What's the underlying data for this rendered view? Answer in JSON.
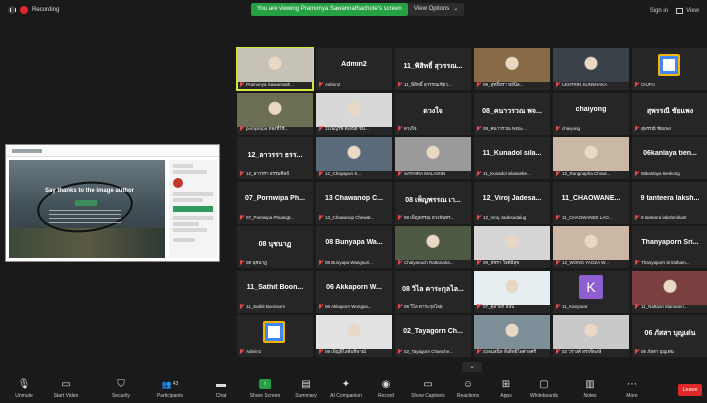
{
  "topbar": {
    "recording_label": "Recording",
    "viewing_banner": "You are viewing Pramonya Sawannathachote's screen",
    "view_options_label": "View Options",
    "sign_in_label": "Sign in",
    "view_label": "View"
  },
  "share_preview": {
    "headline": "Say thanks to the image author"
  },
  "tiles": [
    {
      "name": "",
      "label": "Pramonya Sawannath...",
      "active": true,
      "kind": "photo",
      "color": "#c7c2b6"
    },
    {
      "name": "Admin2",
      "label": "Admin2",
      "kind": "name"
    },
    {
      "name": "11_พิสิทธิ์ สุวรรณ...",
      "label": "11_พิสิทธิ์ สุวรรณเขียว...",
      "kind": "name"
    },
    {
      "name": "",
      "label": "08_สุทธิ์ทรา หลีนิล...",
      "kind": "photo",
      "color": "#8a6b48"
    },
    {
      "name": "",
      "label": "LENTRIN SUNSHAKA",
      "kind": "photo",
      "color": "#3b4148"
    },
    {
      "name": "",
      "label": "CIUFU",
      "kind": "logo",
      "color": "#ffffff"
    },
    {
      "name": "",
      "label": "pornpimpa ทองที่ใช้...",
      "kind": "photo",
      "color": "#6b6e52"
    },
    {
      "name": "",
      "label": "11เพ็ญรพี ดีเสนีย์ ขัน...",
      "kind": "photo",
      "color": "#d8d8d8"
    },
    {
      "name": "ดวงใจ",
      "label": "ดวงใจ",
      "kind": "name"
    },
    {
      "name": "08_คนาวรวณ พจ...",
      "label": "08_คนาวรวณ พจนะ...",
      "kind": "name"
    },
    {
      "name": "chaiyong",
      "label": "chaiyong",
      "kind": "name"
    },
    {
      "name": "สุพรรณี ชัยแพง",
      "label": "สุพรรณี ชัยแพง",
      "kind": "name"
    },
    {
      "name": "12_ลาวรรา ธรร...",
      "label": "12_ลาวรรา ธรรมศิลป์",
      "kind": "name"
    },
    {
      "name": "",
      "label": "12_Chayapon S...",
      "kind": "photo",
      "color": "#5a6a7a"
    },
    {
      "name": "",
      "label": "SATHIRA MALAISIN",
      "kind": "photo",
      "color": "#9a9a9a"
    },
    {
      "name": "11_Kunadol sila...",
      "label": "11_Kunadol silasuebe...",
      "kind": "name"
    },
    {
      "name": "",
      "label": "12_Rungnapha Chowi...",
      "kind": "photo",
      "color": "#c9b9a3"
    },
    {
      "name": "06kanlaya tien...",
      "label": "06kanlaya tienkong",
      "kind": "name"
    },
    {
      "name": "07_Pornwipa Ph...",
      "label": "07_Pornwipa Phuangt...",
      "kind": "name"
    },
    {
      "name": "13 Chawanop C...",
      "label": "13_Chawanop Chewat...",
      "kind": "name"
    },
    {
      "name": "08 เพ็ญพรรณ เา...",
      "label": "08 เพ็ญพรรณ ดวงจันทร...",
      "kind": "name"
    },
    {
      "name": "12_Viroj Jadesa...",
      "label": "12_Viroj Jadesadalug",
      "kind": "name"
    },
    {
      "name": "11_CHAOWANE...",
      "label": "11_CHAOWANEE LAO...",
      "kind": "name"
    },
    {
      "name": "9 tanteera laksh...",
      "label": "9 tanteera lakshmihant",
      "kind": "name"
    },
    {
      "name": "08 นุชนาฏ",
      "label": "08 นุชนาฏ",
      "kind": "name"
    },
    {
      "name": "08 Bunyapa Wa...",
      "label": "08 Bunyapa Wangsuri...",
      "kind": "name"
    },
    {
      "name": "",
      "label": "Chalyanuch Rattanaha...",
      "kind": "photo",
      "color": "#4f5a44"
    },
    {
      "name": "",
      "label": "08_พัชรา ใจดีมีสุข",
      "kind": "photo",
      "color": "#d6d6d6"
    },
    {
      "name": "",
      "label": "12_WONG YAOZA W...",
      "kind": "photo",
      "color": "#cbb7a4"
    },
    {
      "name": "Thanyaporn Sri...",
      "label": "Thanyaporn Sriratham...",
      "kind": "name"
    },
    {
      "name": "11_Sathit Boon...",
      "label": "11_Sathit Boonsom",
      "kind": "name"
    },
    {
      "name": "06 Akkaporn W...",
      "label": "06 Akkaporn Wongsa...",
      "kind": "name"
    },
    {
      "name": "08 วิไล คาระกุลไล...",
      "label": "08 วิไล ดาระกุลไลย",
      "kind": "name"
    },
    {
      "name": "",
      "label": "07_ตุลาพร หลิน",
      "kind": "photo",
      "color": "#e6eef2"
    },
    {
      "name": "",
      "label": "11_Kanyarat",
      "kind": "letter",
      "color": "#8e5fd0",
      "letter": "K"
    },
    {
      "name": "",
      "label": "11_Nattaon Manaseri...",
      "kind": "photo",
      "color": "#7b3f3f"
    },
    {
      "name": "",
      "label": "Admin1",
      "kind": "logo",
      "color": "#ffffff"
    },
    {
      "name": "",
      "label": "09 เพ็ญพิไลลี่มทิพาณ์",
      "kind": "photo",
      "color": "#e2e2e2"
    },
    {
      "name": "02_Tayagorn Ch...",
      "label": "02_Tayagorn Chanche...",
      "kind": "name"
    },
    {
      "name": "",
      "label": "02ลมสนิท ทั้งสิทธิไพศาลศรี",
      "kind": "photo",
      "color": "#7f8f9a"
    },
    {
      "name": "",
      "label": "02 วรางค์ สรกพิพงษ์",
      "kind": "photo",
      "color": "#c9c9c9"
    },
    {
      "name": "06 ภัสสา บุญเด่น",
      "label": "06 ภัสสา บุญเด่น",
      "kind": "name"
    }
  ],
  "toolbar": {
    "unmute": "Unmute",
    "start_video": "Start Video",
    "security": "Security",
    "participants": "Participants",
    "participants_count": "43",
    "chat": "Chat",
    "share_screen": "Share Screen",
    "summary": "Summary",
    "ai_companion": "AI Companion",
    "record": "Record",
    "show_captions": "Show Captions",
    "reactions": "Reactions",
    "apps": "Apps",
    "whiteboards": "Whiteboards",
    "notes": "Notes",
    "more": "More",
    "leave": "Leave"
  },
  "colors": {
    "background": "#1a1a1a",
    "tile": "#262626",
    "active_border": "#d6e63a",
    "share_green": "#25a042",
    "leave_red": "#e02828",
    "mute_red": "#e5484d"
  }
}
